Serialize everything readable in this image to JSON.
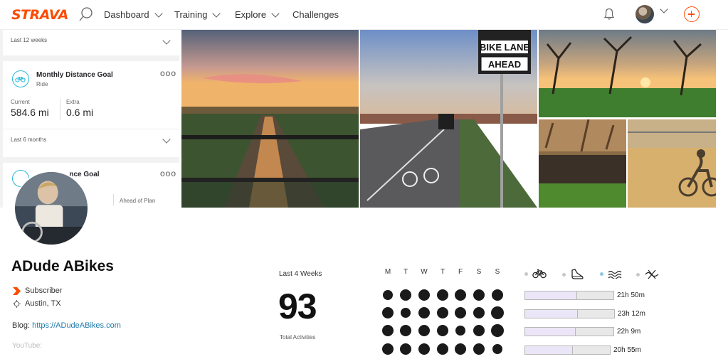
{
  "nav": {
    "logo": "STRAVA",
    "items": [
      {
        "label": "Dashboard"
      },
      {
        "label": "Training"
      },
      {
        "label": "Explore"
      },
      {
        "label": "Challenges"
      }
    ]
  },
  "goals": {
    "period_1": "Last 12 weeks",
    "card": {
      "title": "Monthly Distance Goal",
      "sport": "Ride",
      "current_label": "Current",
      "current_value": "584.6 mi",
      "extra_label": "Extra",
      "extra_value": "0.6 mi",
      "menu": "ooo"
    },
    "period_2": "Last 6 months",
    "card2": {
      "title_fragment": "...nce Goal",
      "status": "Ahead of Plan",
      "menu": "ooo"
    }
  },
  "profile": {
    "name": "ADude ABikes",
    "badge": "Subscriber",
    "location": "Austin, TX",
    "blog_label": "Blog:",
    "blog_url": "https://ADudeABikes.com",
    "youtube_label": "YouTube:"
  },
  "stats": {
    "period": "Last 4 Weeks",
    "total": "93",
    "total_label": "Total Activities",
    "days": [
      "M",
      "T",
      "W",
      "T",
      "F",
      "S",
      "S"
    ],
    "weeks": [
      [
        0.55,
        0.8,
        0.8,
        0.8,
        0.8,
        0.8,
        0.8
      ],
      [
        0.8,
        0.55,
        0.8,
        0.8,
        0.8,
        0.8,
        0.95
      ],
      [
        0.8,
        0.8,
        0.8,
        0.8,
        0.55,
        0.8,
        1.0
      ],
      [
        0.8,
        0.8,
        0.8,
        0.8,
        0.8,
        0.8,
        0.55
      ]
    ],
    "sports": [
      {
        "icon": "bike-icon",
        "active": false
      },
      {
        "icon": "run-shoe-icon",
        "active": false
      },
      {
        "icon": "swim-icon",
        "active": true
      },
      {
        "icon": "other-icon",
        "active": false
      }
    ],
    "durations": [
      {
        "label": "21h 50m",
        "fill": 0.59
      },
      {
        "label": "23h 12m",
        "fill": 0.59
      },
      {
        "label": "22h 9m",
        "fill": 0.57
      },
      {
        "label": "20h 55m",
        "fill": 0.56
      }
    ]
  },
  "colors": {
    "brand": "#fc4c02",
    "goal_accent": "#2bb7d6",
    "link": "#1f7bab"
  }
}
